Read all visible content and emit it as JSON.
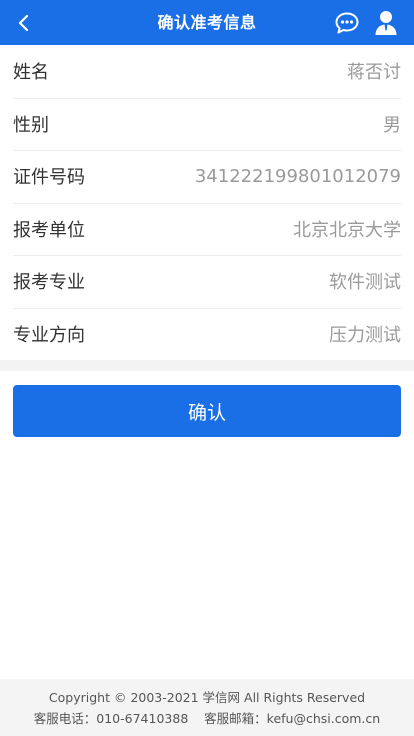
{
  "header": {
    "title": "确认准考信息",
    "icons": {
      "back": "chevron-left-icon",
      "chat": "chat-bubble-icon",
      "user": "user-icon"
    }
  },
  "info": {
    "name": {
      "label": "姓名",
      "value": "蒋否讨"
    },
    "gender": {
      "label": "性别",
      "value": "男"
    },
    "id_number": {
      "label": "证件号码",
      "value": "341222199801012079"
    },
    "unit": {
      "label": "报考单位",
      "value": "北京北京大学"
    },
    "major": {
      "label": "报考专业",
      "value": "软件测试"
    },
    "direction": {
      "label": "专业方向",
      "value": "压力测试"
    }
  },
  "actions": {
    "confirm_label": "确认"
  },
  "footer": {
    "copyright": "Copyright © 2003-2021 学信网 All Rights Reserved",
    "contact": "客服电话：010-67410388    客服邮箱：kefu@chsi.com.cn"
  },
  "colors": {
    "primary": "#1a6fe6",
    "value_text": "#9a9a9a",
    "label_text": "#333333"
  }
}
